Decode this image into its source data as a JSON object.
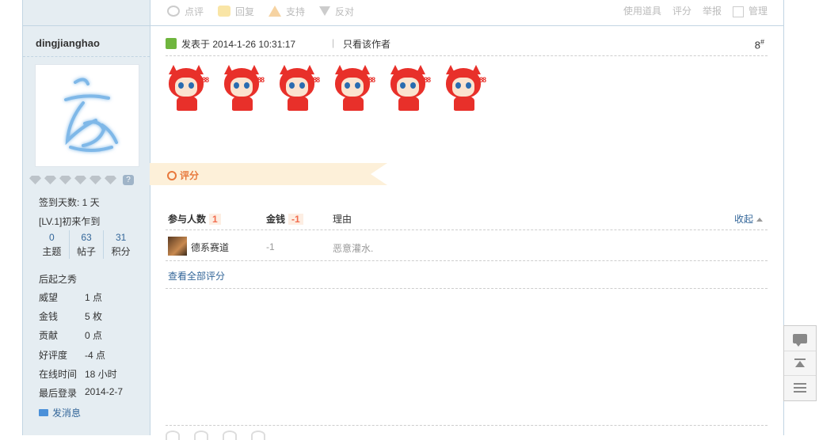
{
  "top_actions": {
    "items": [
      "点评",
      "回复",
      "支持",
      "反对"
    ],
    "right": [
      "使用道具",
      "评分",
      "举报",
      "管理"
    ]
  },
  "user": {
    "name": "dingjianghao",
    "sign_days": "签到天数: 1 天",
    "level": "[LV.1]初来乍到",
    "stats": [
      {
        "num": "0",
        "label": "主题"
      },
      {
        "num": "63",
        "label": "帖子"
      },
      {
        "num": "31",
        "label": "积分"
      }
    ],
    "group": "后起之秀",
    "props": [
      {
        "k": "威望",
        "v": "1 点"
      },
      {
        "k": "金钱",
        "v": "5 枚"
      },
      {
        "k": "贡献",
        "v": "0 点"
      },
      {
        "k": "好评度",
        "v": "-4 点"
      },
      {
        "k": "在线时间",
        "v": "18 小时"
      },
      {
        "k": "最后登录",
        "v": "2014-2-7"
      }
    ],
    "send_msg": "发消息"
  },
  "post": {
    "time": "发表于 2014-1-26 10:31:17",
    "sep": "|",
    "only_author": "只看该作者",
    "floor": "8",
    "floor_sup": "#",
    "emote_count": 6,
    "emote_tear": "88"
  },
  "rating": {
    "title": "评分",
    "headers": {
      "participants": "参与人数",
      "participants_count": "1",
      "money": "金钱",
      "money_total": "-1",
      "reason": "理由",
      "collapse": "收起"
    },
    "rows": [
      {
        "name": "德系赛道",
        "value": "-1",
        "reason": "恶意灌水."
      }
    ],
    "view_all": "查看全部评分"
  }
}
